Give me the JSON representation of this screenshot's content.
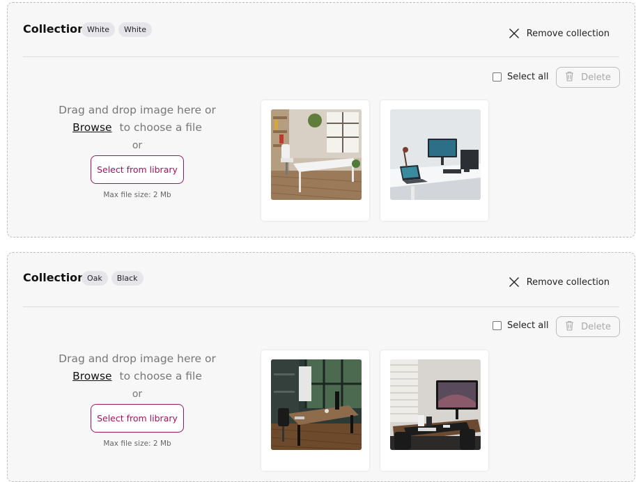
{
  "collections": [
    {
      "title": "Collection",
      "tags": [
        "White",
        "White"
      ],
      "remove_label": "Remove collection",
      "select_all_label": "Select all",
      "delete_label": "Delete",
      "drop": {
        "line1": "Drag and drop image here or",
        "browse": "Browse",
        "line2_rest": "to choose a file",
        "or": "or",
        "library_button": "Select from library",
        "max_size": "Max file size: 2 Mb"
      },
      "images": [
        "white-desk-loft-photo",
        "white-desk-monitor-laptop-photo"
      ]
    },
    {
      "title": "Collection",
      "tags": [
        "Oak",
        "Black"
      ],
      "remove_label": "Remove collection",
      "select_all_label": "Select all",
      "delete_label": "Delete",
      "drop": {
        "line1": "Drag and drop image here or",
        "browse": "Browse",
        "line2_rest": "to choose a file",
        "or": "or",
        "library_button": "Select from library",
        "max_size": "Max file size: 2 Mb"
      },
      "images": [
        "oak-desk-office-photo",
        "black-desk-monitor-photo"
      ]
    }
  ],
  "colors": {
    "accent": "#a0135e",
    "panel_bg": "#f7f7f7",
    "tag_bg": "#e6e6ea"
  },
  "icons": {
    "remove": "close-icon",
    "delete": "trash-icon"
  }
}
